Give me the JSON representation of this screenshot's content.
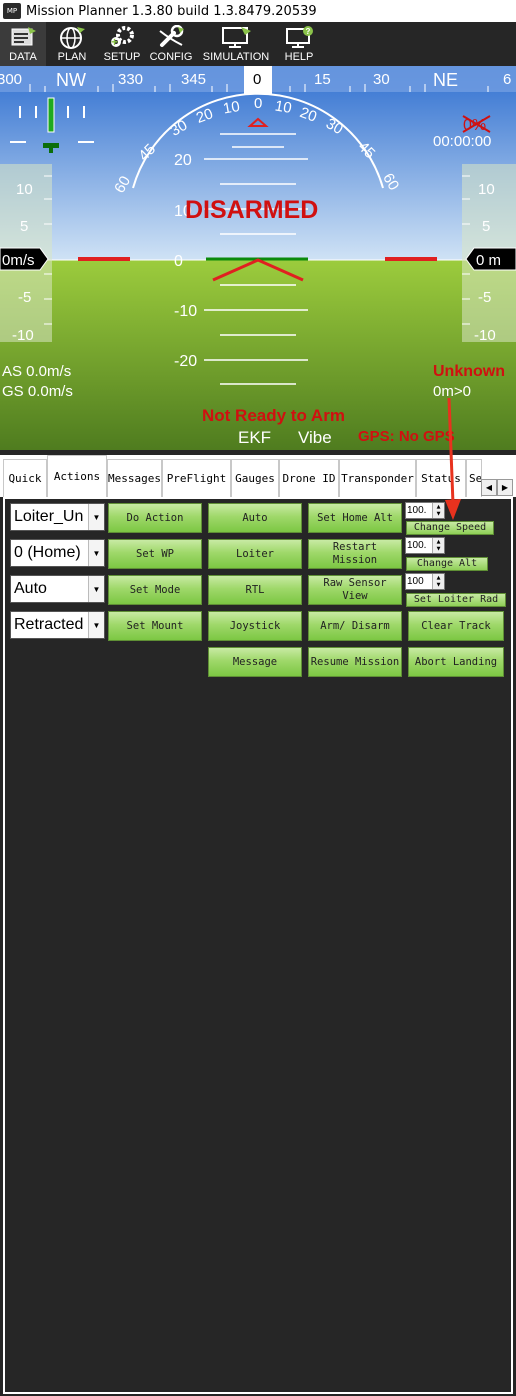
{
  "window": {
    "title": "Mission Planner 1.3.80 build 1.3.8479.20539",
    "logo_text": "MP"
  },
  "menu": [
    {
      "label": "DATA",
      "icon": "data-icon"
    },
    {
      "label": "PLAN",
      "icon": "globe-icon"
    },
    {
      "label": "SETUP",
      "icon": "gears-icon"
    },
    {
      "label": "CONFIG",
      "icon": "wrench-icon"
    },
    {
      "label": "SIMULATION",
      "icon": "monitor-plane-icon"
    },
    {
      "label": "HELP",
      "icon": "monitor-help-icon"
    }
  ],
  "hud": {
    "heading": {
      "labels": [
        "300",
        "NW",
        "330",
        "345",
        "0",
        "15",
        "30",
        "NE",
        "6"
      ],
      "current": "0"
    },
    "pitch_scale": [
      "20",
      "10",
      "0",
      "-10",
      "-20"
    ],
    "roll_scale": [
      "60",
      "45",
      "30",
      "20",
      "10",
      "0",
      "10",
      "20",
      "30",
      "45",
      "60"
    ],
    "left_tape": [
      "10",
      "5",
      "-5",
      "-10"
    ],
    "right_tape": [
      "10",
      "5",
      "-5",
      "-10"
    ],
    "speed_value": "0m/s",
    "alt_value": "0 m",
    "battery": "0%",
    "timer": "00:00:00",
    "status": "DISARMED",
    "airspeed": "AS 0.0m/s",
    "groundspeed": "GS 0.0m/s",
    "mode": "Unknown",
    "wp_distance": "0m>0",
    "arm_message": "Not Ready to Arm",
    "ekf": "EKF",
    "vibe": "Vibe",
    "gps": "GPS: No GPS",
    "colors": {
      "sky": "#5a8fd8",
      "ground": "#7fb833",
      "warning": "#d01010"
    }
  },
  "tabs": [
    "Quick",
    "Actions",
    "Messages",
    "PreFlight",
    "Gauges",
    "Drone ID",
    "Transponder",
    "Status",
    "Se"
  ],
  "active_tab": "Actions",
  "actions": {
    "combos": [
      "Loiter_Un",
      "0 (Home)",
      "Auto",
      "Retracted"
    ],
    "buttons": {
      "do_action": "Do Action",
      "auto": "Auto",
      "set_home_alt": "Set Home Alt",
      "set_wp": "Set WP",
      "loiter": "Loiter",
      "restart_mission": "Restart Mission",
      "set_mode": "Set Mode",
      "rtl": "RTL",
      "raw_sensor_view": "Raw Sensor View",
      "set_mount": "Set Mount",
      "joystick": "Joystick",
      "arm_disarm": "Arm/ Disarm",
      "clear_track": "Clear Track",
      "message": "Message",
      "resume_mission": "Resume Mission",
      "abort_landing": "Abort Landing",
      "change_speed": "Change Speed",
      "change_alt": "Change Alt",
      "set_loiter_rad": "Set Loiter Rad"
    },
    "spinners": [
      "100.",
      "100.",
      "100"
    ]
  }
}
